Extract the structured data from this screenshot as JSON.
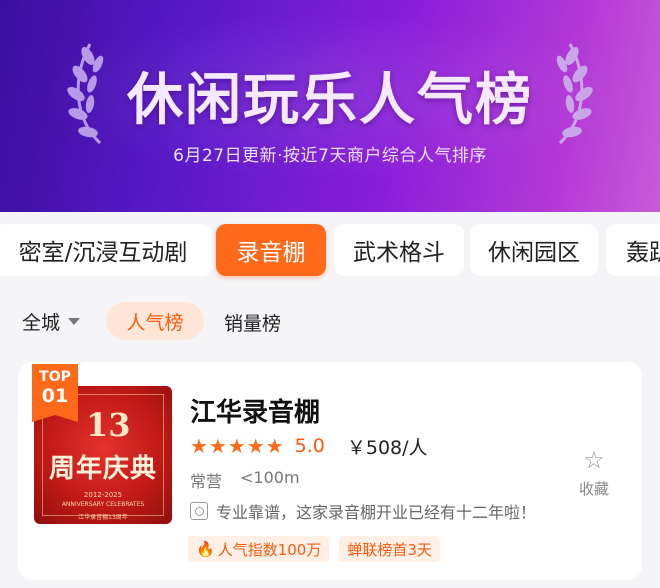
{
  "banner": {
    "title": "休闲玩乐人气榜",
    "subtitle": "6月27日更新·按近7天商户综合人气排序"
  },
  "category_tabs": [
    {
      "label": "密室/沉浸互动剧",
      "active": false
    },
    {
      "label": "录音棚",
      "active": true
    },
    {
      "label": "武术格斗",
      "active": false
    },
    {
      "label": "休闲园区",
      "active": false
    },
    {
      "label": "轰趴",
      "active": false
    }
  ],
  "sort_bar": {
    "city": "全城",
    "popular": "人气榜",
    "sales": "销量榜"
  },
  "card": {
    "badge_top": "TOP",
    "badge_rank": "01",
    "thumb": {
      "num": "13",
      "headline": "周年庆典",
      "years": "2012-2025",
      "english": "ANNIVERSARY CELEBRATES",
      "caption": "江华录音棚13周年"
    },
    "name": "江华录音棚",
    "stars": "★★★★★",
    "rating": "5.0",
    "price": "￥508/人",
    "status": "常营",
    "distance": "<100m",
    "review": "专业靠谱，这家录音棚开业已经有十二年啦！",
    "tags": [
      {
        "text": "人气指数100万",
        "icon": "flame-icon"
      },
      {
        "text": "蝉联榜首3天"
      }
    ],
    "favorite_label": "收藏"
  },
  "colors": {
    "accent": "#ff6a1a",
    "banner_start": "#3a0f9e",
    "banner_end": "#c85bd8"
  }
}
